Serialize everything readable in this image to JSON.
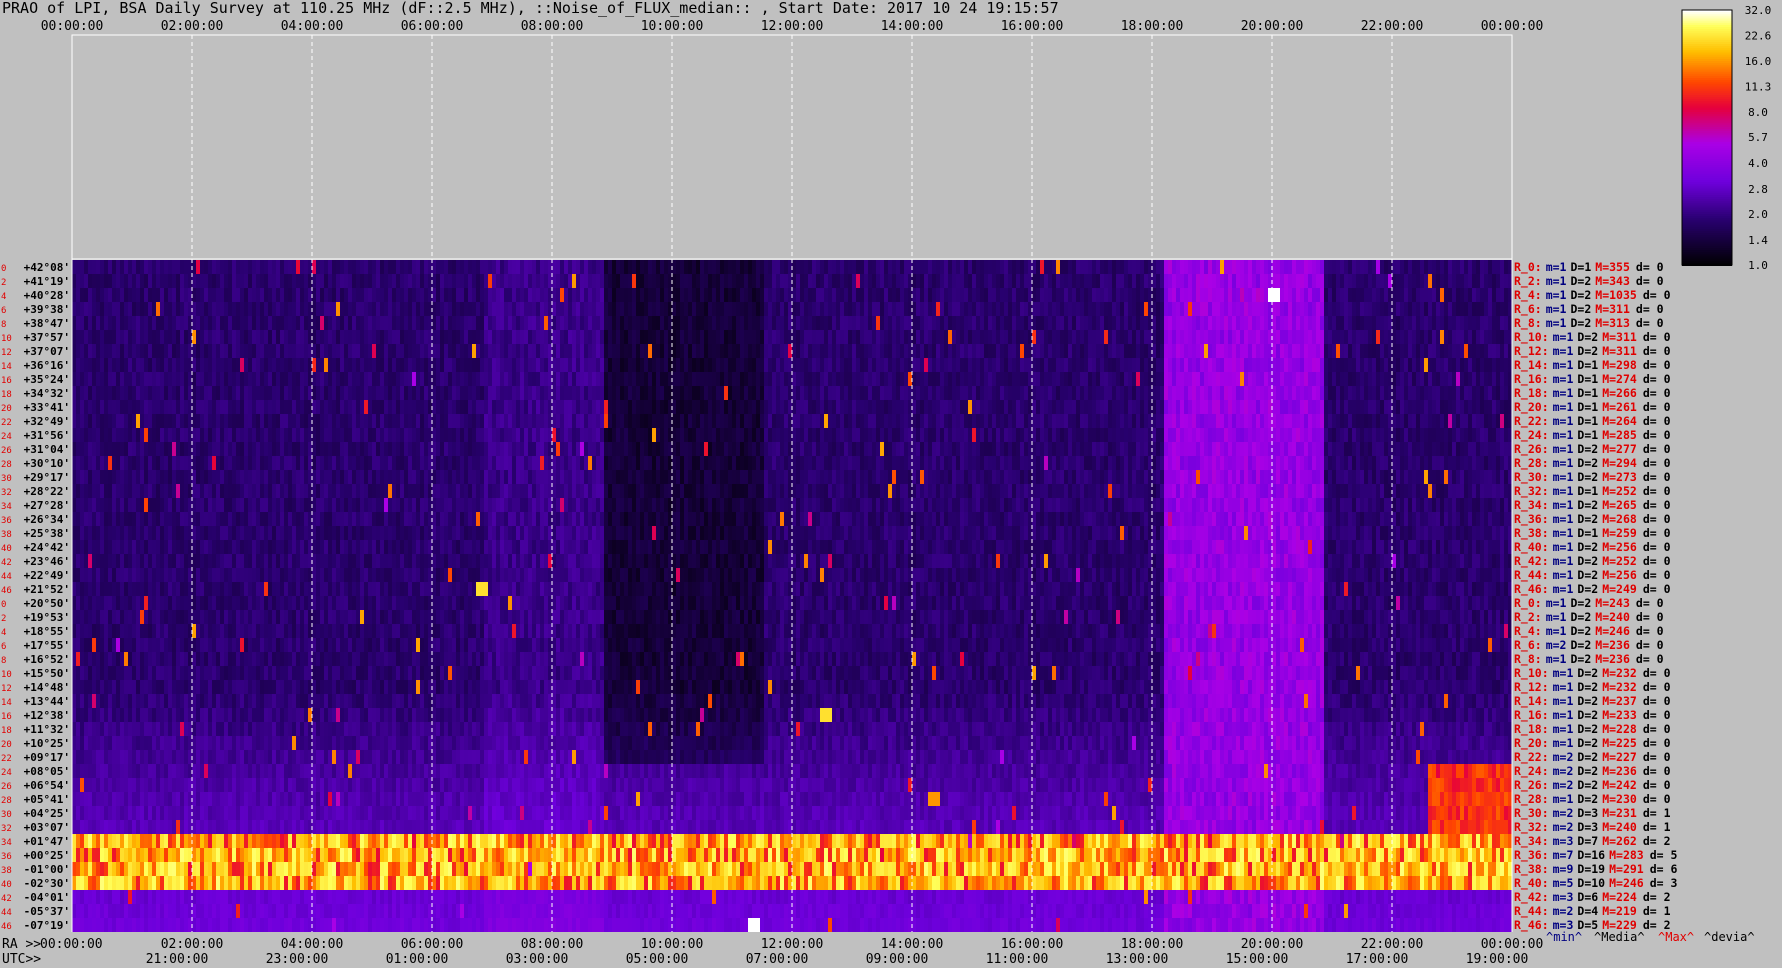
{
  "title": "PRAO of LPI, BSA Daily Survey at 110.25 MHz (dF::2.5 MHz), ::Noise_of_FLUX_median:: , Start Date: 2017 10 24 19:15:57",
  "colors": {
    "background": "#c0c0c0",
    "grid": "#ffffff",
    "index_text": "#e00000",
    "min_text": "#000080",
    "max_text": "#e00000"
  },
  "chart_data": {
    "type": "heatmap",
    "title": "PRAO of LPI, BSA Daily Survey at 110.25 MHz (dF::2.5 MHz), ::Noise_of_FLUX_median:: , Start Date: 2017 10 24 19:15:57",
    "x_top_ticks": [
      "00:00:00",
      "02:00:00",
      "04:00:00",
      "06:00:00",
      "08:00:00",
      "10:00:00",
      "12:00:00",
      "14:00:00",
      "16:00:00",
      "18:00:00",
      "20:00:00",
      "22:00:00",
      "00:00:00"
    ],
    "x_ra_ticks": [
      "00:00:00",
      "02:00:00",
      "04:00:00",
      "06:00:00",
      "08:00:00",
      "10:00:00",
      "12:00:00",
      "14:00:00",
      "16:00:00",
      "18:00:00",
      "20:00:00",
      "22:00:00",
      "00:00:00"
    ],
    "x_utc_ticks": [
      "21:00:00",
      "23:00:00",
      "01:00:00",
      "03:00:00",
      "05:00:00",
      "07:00:00",
      "09:00:00",
      "11:00:00",
      "13:00:00",
      "15:00:00",
      "17:00:00",
      "19:00:00"
    ],
    "ra_label": "RA >>",
    "utc_label": "UTC>>",
    "declinations": [
      "+42°08'",
      "+41°19'",
      "+40°28'",
      "+39°38'",
      "+38°47'",
      "+37°57'",
      "+37°07'",
      "+36°16'",
      "+35°24'",
      "+34°32'",
      "+33°41'",
      "+32°49'",
      "+31°56'",
      "+31°04'",
      "+30°10'",
      "+29°17'",
      "+28°22'",
      "+27°28'",
      "+26°34'",
      "+25°38'",
      "+24°42'",
      "+23°46'",
      "+22°49'",
      "+21°52'",
      "+20°50'",
      "+19°53'",
      "+18°55'",
      "+17°55'",
      "+16°52'",
      "+15°50'",
      "+14°48'",
      "+13°44'",
      "+12°38'",
      "+11°32'",
      "+10°25'",
      "+09°17'",
      "+08°05'",
      "+06°54'",
      "+05°41'",
      "+04°25'",
      "+03°07'",
      "+01°47'",
      "+00°25'",
      "-01°00'",
      "-02°30'",
      "-04°01'",
      "-05°37'",
      "-07°19'"
    ],
    "row_indices": [
      "0",
      "2",
      "4",
      "6",
      "8",
      "10",
      "12",
      "14",
      "16",
      "18",
      "20",
      "22",
      "24",
      "26",
      "28",
      "30",
      "32",
      "34",
      "36",
      "38",
      "40",
      "42",
      "44",
      "46",
      "0",
      "2",
      "4",
      "6",
      "8",
      "10",
      "12",
      "14",
      "16",
      "18",
      "20",
      "22",
      "24",
      "26",
      "28",
      "30",
      "32",
      "34",
      "36",
      "38",
      "40",
      "42",
      "44",
      "46"
    ],
    "receiver_stats": [
      {
        "r": "R_0:",
        "m": "m=1",
        "d": "D=1",
        "M": "M=355",
        "dev": "d= 0"
      },
      {
        "r": "R_2:",
        "m": "m=1",
        "d": "D=2",
        "M": "M=343",
        "dev": "d= 0"
      },
      {
        "r": "R_4:",
        "m": "m=1",
        "d": "D=2",
        "M": "M=1035",
        "dev": "d= 0"
      },
      {
        "r": "R_6:",
        "m": "m=1",
        "d": "D=2",
        "M": "M=311",
        "dev": "d= 0"
      },
      {
        "r": "R_8:",
        "m": "m=1",
        "d": "D=2",
        "M": "M=313",
        "dev": "d= 0"
      },
      {
        "r": "R_10:",
        "m": "m=1",
        "d": "D=2",
        "M": "M=311",
        "dev": "d= 0"
      },
      {
        "r": "R_12:",
        "m": "m=1",
        "d": "D=2",
        "M": "M=311",
        "dev": "d= 0"
      },
      {
        "r": "R_14:",
        "m": "m=1",
        "d": "D=1",
        "M": "M=298",
        "dev": "d= 0"
      },
      {
        "r": "R_16:",
        "m": "m=1",
        "d": "D=1",
        "M": "M=274",
        "dev": "d= 0"
      },
      {
        "r": "R_18:",
        "m": "m=1",
        "d": "D=1",
        "M": "M=266",
        "dev": "d= 0"
      },
      {
        "r": "R_20:",
        "m": "m=1",
        "d": "D=1",
        "M": "M=261",
        "dev": "d= 0"
      },
      {
        "r": "R_22:",
        "m": "m=1",
        "d": "D=1",
        "M": "M=264",
        "dev": "d= 0"
      },
      {
        "r": "R_24:",
        "m": "m=1",
        "d": "D=1",
        "M": "M=285",
        "dev": "d= 0"
      },
      {
        "r": "R_26:",
        "m": "m=1",
        "d": "D=2",
        "M": "M=277",
        "dev": "d= 0"
      },
      {
        "r": "R_28:",
        "m": "m=1",
        "d": "D=2",
        "M": "M=294",
        "dev": "d= 0"
      },
      {
        "r": "R_30:",
        "m": "m=1",
        "d": "D=2",
        "M": "M=273",
        "dev": "d= 0"
      },
      {
        "r": "R_32:",
        "m": "m=1",
        "d": "D=1",
        "M": "M=252",
        "dev": "d= 0"
      },
      {
        "r": "R_34:",
        "m": "m=1",
        "d": "D=2",
        "M": "M=265",
        "dev": "d= 0"
      },
      {
        "r": "R_36:",
        "m": "m=1",
        "d": "D=2",
        "M": "M=268",
        "dev": "d= 0"
      },
      {
        "r": "R_38:",
        "m": "m=1",
        "d": "D=1",
        "M": "M=259",
        "dev": "d= 0"
      },
      {
        "r": "R_40:",
        "m": "m=1",
        "d": "D=2",
        "M": "M=256",
        "dev": "d= 0"
      },
      {
        "r": "R_42:",
        "m": "m=1",
        "d": "D=2",
        "M": "M=252",
        "dev": "d= 0"
      },
      {
        "r": "R_44:",
        "m": "m=1",
        "d": "D=2",
        "M": "M=256",
        "dev": "d= 0"
      },
      {
        "r": "R_46:",
        "m": "m=1",
        "d": "D=2",
        "M": "M=249",
        "dev": "d= 0"
      },
      {
        "r": "R_0:",
        "m": "m=1",
        "d": "D=2",
        "M": "M=243",
        "dev": "d= 0"
      },
      {
        "r": "R_2:",
        "m": "m=1",
        "d": "D=2",
        "M": "M=240",
        "dev": "d= 0"
      },
      {
        "r": "R_4:",
        "m": "m=1",
        "d": "D=2",
        "M": "M=246",
        "dev": "d= 0"
      },
      {
        "r": "R_6:",
        "m": "m=2",
        "d": "D=2",
        "M": "M=236",
        "dev": "d= 0"
      },
      {
        "r": "R_8:",
        "m": "m=1",
        "d": "D=2",
        "M": "M=236",
        "dev": "d= 0"
      },
      {
        "r": "R_10:",
        "m": "m=1",
        "d": "D=2",
        "M": "M=232",
        "dev": "d= 0"
      },
      {
        "r": "R_12:",
        "m": "m=1",
        "d": "D=2",
        "M": "M=232",
        "dev": "d= 0"
      },
      {
        "r": "R_14:",
        "m": "m=1",
        "d": "D=2",
        "M": "M=237",
        "dev": "d= 0"
      },
      {
        "r": "R_16:",
        "m": "m=1",
        "d": "D=2",
        "M": "M=233",
        "dev": "d= 0"
      },
      {
        "r": "R_18:",
        "m": "m=1",
        "d": "D=2",
        "M": "M=228",
        "dev": "d= 0"
      },
      {
        "r": "R_20:",
        "m": "m=1",
        "d": "D=2",
        "M": "M=225",
        "dev": "d= 0"
      },
      {
        "r": "R_22:",
        "m": "m=2",
        "d": "D=2",
        "M": "M=227",
        "dev": "d= 0"
      },
      {
        "r": "R_24:",
        "m": "m=2",
        "d": "D=2",
        "M": "M=236",
        "dev": "d= 0"
      },
      {
        "r": "R_26:",
        "m": "m=2",
        "d": "D=2",
        "M": "M=242",
        "dev": "d= 0"
      },
      {
        "r": "R_28:",
        "m": "m=1",
        "d": "D=2",
        "M": "M=230",
        "dev": "d= 0"
      },
      {
        "r": "R_30:",
        "m": "m=2",
        "d": "D=3",
        "M": "M=231",
        "dev": "d= 1"
      },
      {
        "r": "R_32:",
        "m": "m=2",
        "d": "D=3",
        "M": "M=240",
        "dev": "d= 1"
      },
      {
        "r": "R_34:",
        "m": "m=3",
        "d": "D=7",
        "M": "M=262",
        "dev": "d= 2"
      },
      {
        "r": "R_36:",
        "m": "m=7",
        "d": "D=16",
        "M": "M=283",
        "dev": "d= 5"
      },
      {
        "r": "R_38:",
        "m": "m=9",
        "d": "D=19",
        "M": "M=291",
        "dev": "d= 6"
      },
      {
        "r": "R_40:",
        "m": "m=5",
        "d": "D=10",
        "M": "M=246",
        "dev": "d= 3"
      },
      {
        "r": "R_42:",
        "m": "m=3",
        "d": "D=6",
        "M": "M=224",
        "dev": "d= 2"
      },
      {
        "r": "R_44:",
        "m": "m=2",
        "d": "D=4",
        "M": "M=219",
        "dev": "d= 1"
      },
      {
        "r": "R_46:",
        "m": "m=3",
        "d": "D=5",
        "M": "M=229",
        "dev": "d= 2"
      }
    ],
    "legend_footer": [
      "^min^",
      "^Media^",
      "^Max^",
      "^devia^"
    ],
    "colorbar_ticks": [
      "32.0",
      "22.6",
      "16.0",
      "11.3",
      "8.0",
      "5.7",
      "4.0",
      "2.8",
      "2.0",
      "1.4",
      "1.0"
    ],
    "colorbar_scale": "log",
    "colorbar_range": [
      1.0,
      32.0
    ],
    "x_range_hours": [
      0,
      24
    ],
    "grid": true,
    "bright_band_rows": [
      41,
      42,
      43,
      44
    ],
    "hot_regions": [
      {
        "ra_hours_start": 18.2,
        "ra_hours_end": 20.8,
        "rows_start": 0,
        "rows_end": 47,
        "level": 5.0
      },
      {
        "ra_hours_start": 22.6,
        "ra_hours_end": 24.0,
        "rows_start": 36,
        "rows_end": 44,
        "level": 12.0
      }
    ],
    "bright_sources": [
      {
        "ra_hours": 20.0,
        "row": 2,
        "level": 32.0
      },
      {
        "ra_hours": 6.8,
        "row": 23,
        "level": 22.0
      },
      {
        "ra_hours": 12.5,
        "row": 32,
        "level": 22.0
      },
      {
        "ra_hours": 11.3,
        "row": 47,
        "level": 32.0
      },
      {
        "ra_hours": 14.3,
        "row": 38,
        "level": 16.0
      }
    ]
  }
}
